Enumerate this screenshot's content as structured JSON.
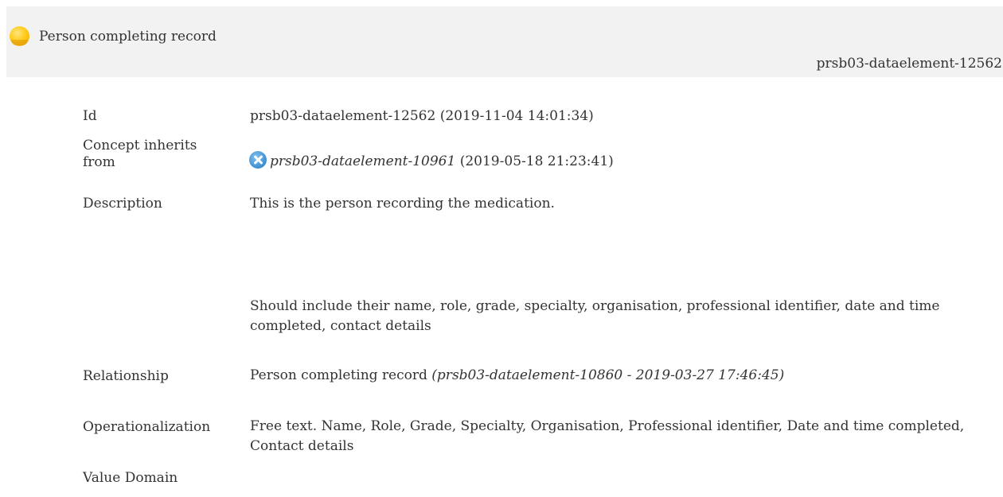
{
  "header": {
    "title": "Person completing record",
    "id": "prsb03-dataelement-12562",
    "status_icon": "status-dot-yellow",
    "status_color": "#ffcc1a"
  },
  "rows": {
    "id": {
      "label": "Id",
      "value": "prsb03-dataelement-12562 (2019-11-04 14:01:34)"
    },
    "concept_inherits": {
      "label": "Concept inherits from",
      "icon": "cancel-circle-icon",
      "ref": "prsb03-dataelement-10961",
      "date": " (2019-05-18 21:23:41)"
    },
    "description": {
      "label": "Description",
      "line1": "This is the person recording the medication.",
      "line2": "Should include their name, role, grade, specialty, organisation, professional identifier, date and time completed, contact details"
    },
    "relationship": {
      "label": "Relationship",
      "value": "Person completing record ",
      "ref": "(prsb03-dataelement-10860 - 2019-03-27 17:46:45)"
    },
    "operationalization": {
      "label": "Operationalization",
      "value": "Free text. Name, Role, Grade, Specialty, Organisation, Professional identifier, Date and time completed, Contact details"
    },
    "value_domain": {
      "label": "Value Domain"
    }
  }
}
